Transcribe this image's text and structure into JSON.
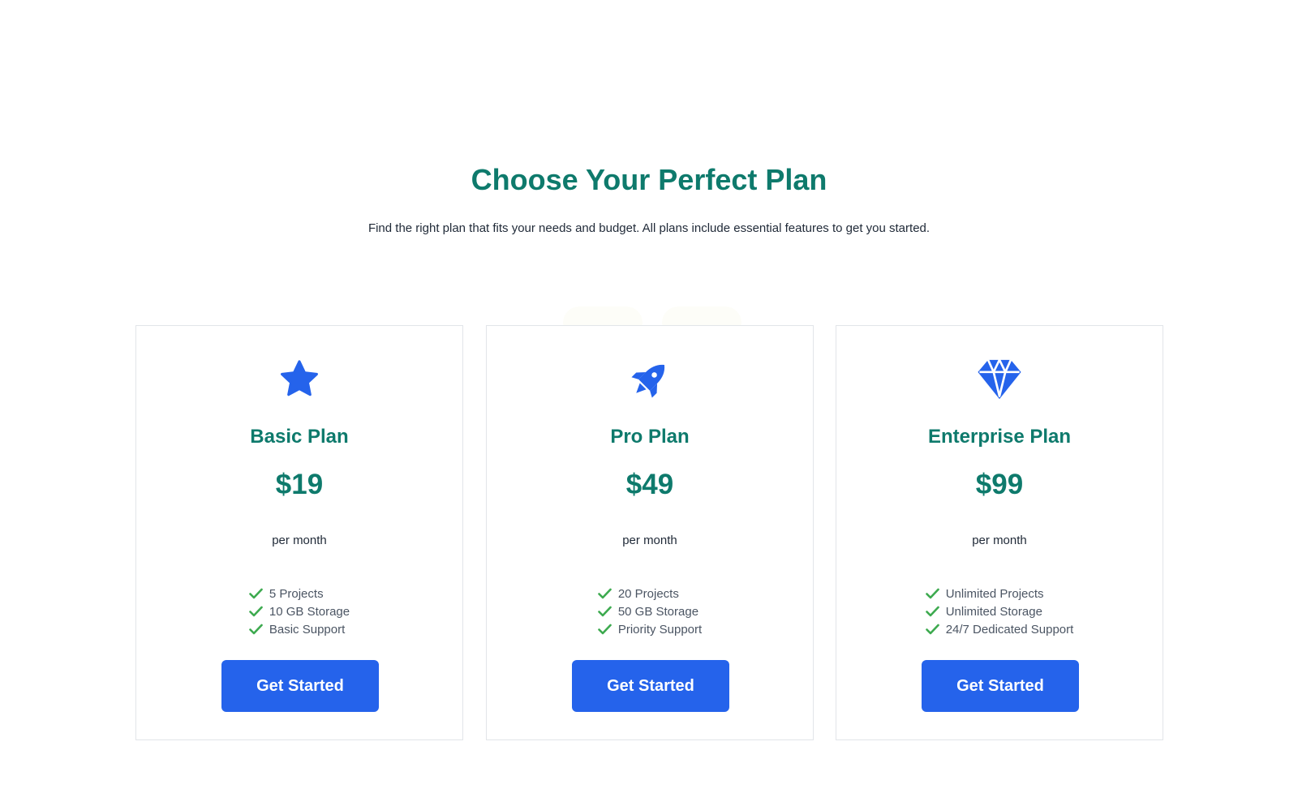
{
  "header": {
    "title": "Choose Your Perfect Plan",
    "subtitle": "Find the right plan that fits your needs and budget. All plans include essential features to get you started."
  },
  "colors": {
    "accent": "#0e7a6c",
    "primary_button": "#2563eb",
    "icon": "#2563eb",
    "check": "#3daa4f"
  },
  "plans": [
    {
      "icon": "star-icon",
      "name": "Basic Plan",
      "price": "$19",
      "period": "per month",
      "features": [
        "5 Projects",
        "10 GB Storage",
        "Basic Support"
      ],
      "cta_label": "Get Started"
    },
    {
      "icon": "rocket-icon",
      "name": "Pro Plan",
      "price": "$49",
      "period": "per month",
      "features": [
        "20 Projects",
        "50 GB Storage",
        "Priority Support"
      ],
      "cta_label": "Get Started"
    },
    {
      "icon": "diamond-icon",
      "name": "Enterprise Plan",
      "price": "$99",
      "period": "per month",
      "features": [
        "Unlimited Projects",
        "Unlimited Storage",
        "24/7 Dedicated Support"
      ],
      "cta_label": "Get Started"
    }
  ]
}
